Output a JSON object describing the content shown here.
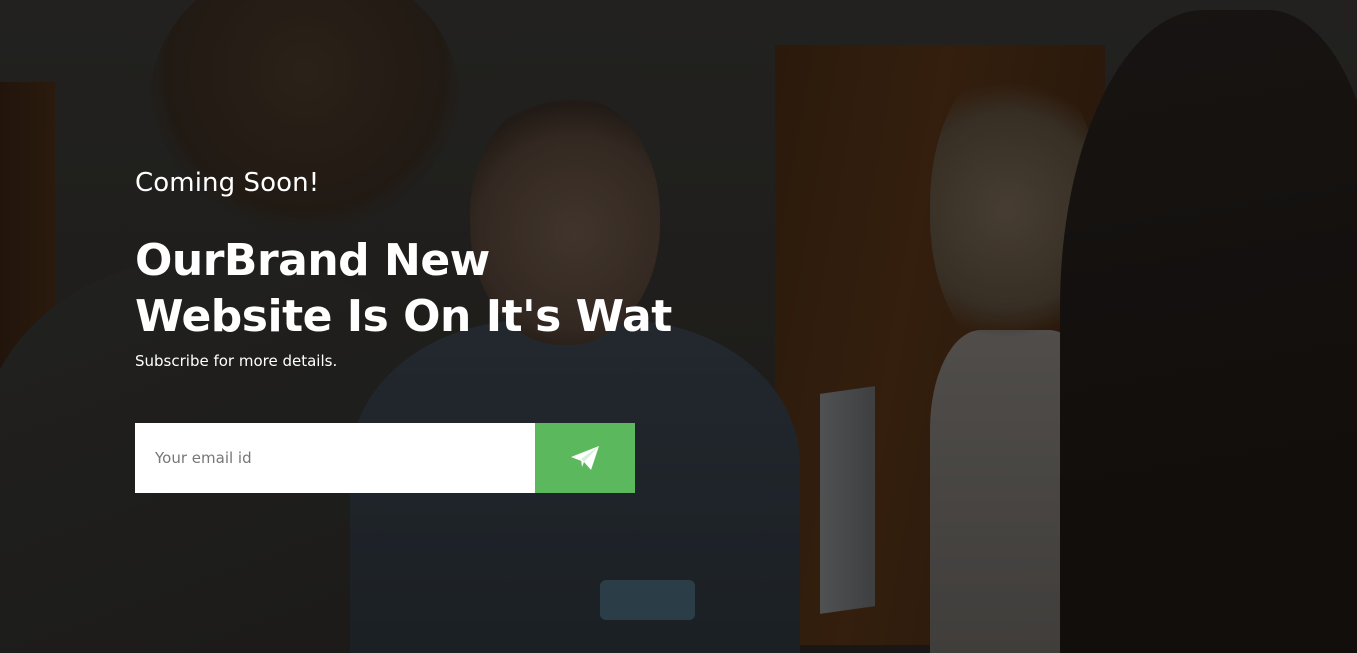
{
  "hero": {
    "kicker": "Coming Soon!",
    "headline_line1": "OurBrand New",
    "headline_line2": "Website Is On It's Wat",
    "subtitle": "Subscribe for more details."
  },
  "subscribe": {
    "email_placeholder": "Your email id",
    "email_value": "",
    "send_icon": "paper-plane-icon"
  },
  "colors": {
    "accent": "#5cb85c",
    "text": "#ffffff",
    "input_bg": "#ffffff"
  }
}
